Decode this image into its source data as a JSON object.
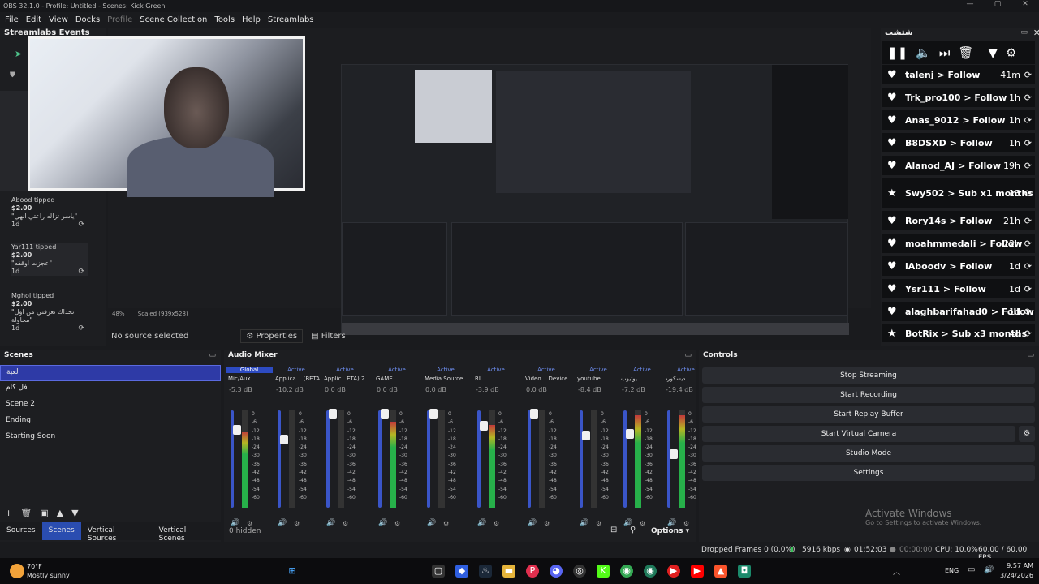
{
  "window": {
    "title": "OBS 32.1.0 - Profile: Untitled - Scenes: Kick Green",
    "controls": [
      "—",
      "▢",
      "✕"
    ]
  },
  "menu": [
    "File",
    "Edit",
    "View",
    "Docks",
    "Profile",
    "Scene Collection",
    "Tools",
    "Help",
    "Streamlabs"
  ],
  "streamlabs_dock": {
    "title": "Streamlabs Events",
    "tips": [
      {
        "name": "Abood tipped",
        "amount": "$2.00",
        "message": "\"ياسر تزاله راعتي انهي\"",
        "age": "1d"
      },
      {
        "name": "Yar111 tipped",
        "amount": "$2.00",
        "message": "\"عجزت اوقفه\"",
        "age": "1d"
      },
      {
        "name": "Mghol tipped",
        "amount": "$2.00",
        "message": "\"اتحداك تعرفني من اول محاولة\"",
        "age": "1d"
      }
    ]
  },
  "preview": {
    "zoom": "48%",
    "scaled": "Scaled (939x528)"
  },
  "source_bar": {
    "status": "No source selected",
    "properties": "Properties",
    "filters": "Filters"
  },
  "chat_dock": {
    "title": "شتشت",
    "events": [
      {
        "user": "talenj",
        "action": "> Follow",
        "time": "41m"
      },
      {
        "user": "Trk_pro100",
        "action": "> Follow",
        "time": "1h"
      },
      {
        "user": "Anas_9012",
        "action": "> Follow",
        "time": "1h"
      },
      {
        "user": "B8DSXD",
        "action": "> Follow",
        "time": "1h"
      },
      {
        "user": "Alanod_AJ",
        "action": "> Follow",
        "time": "19h"
      },
      {
        "user": "Swy502",
        "action": "> Sub x1 months",
        "time": "13"
      },
      {
        "user": "Rory14s",
        "action": "> Follow",
        "time": "21h"
      },
      {
        "user": "moahmmedali",
        "action": "> Follow",
        "time": "22h"
      },
      {
        "user": "iAboodv",
        "action": "> Follow",
        "time": "1d"
      },
      {
        "user": "Ysr111",
        "action": "> Follow",
        "time": "1d"
      },
      {
        "user": "alaghbarifahad0",
        "action": "> Follow",
        "time": "1d"
      },
      {
        "user": "BotRix",
        "action": "> Sub x3 months",
        "time": "4d"
      }
    ]
  },
  "scenes": {
    "title": "Scenes",
    "items": [
      "لعبة",
      "فل كام",
      "Scene 2",
      "Ending",
      "Starting Soon"
    ],
    "selected": 0
  },
  "dock_tabs": [
    "Sources",
    "Scenes",
    "Vertical Sources",
    "Vertical Scenes"
  ],
  "audio_mixer": {
    "title": "Audio Mixer",
    "hidden": "0 hidden",
    "options": "Options",
    "channels": [
      {
        "status": "Global",
        "name": "Mic/Aux",
        "db": "-5.3 dB",
        "level": 0.8,
        "meter": 0.78
      },
      {
        "status": "Active",
        "name": "Applica... (BETA)",
        "db": "-10.2 dB",
        "level": 0.7,
        "meter": 0.0
      },
      {
        "status": "Active",
        "name": "Applic...ETA) 2",
        "db": "0.0 dB",
        "level": 0.97,
        "meter": 0.0
      },
      {
        "status": "Active",
        "name": "GAME",
        "db": "0.0 dB",
        "level": 0.97,
        "meter": 0.88
      },
      {
        "status": "Active",
        "name": "Media Source",
        "db": "0.0 dB",
        "level": 0.97,
        "meter": 0.0
      },
      {
        "status": "Active",
        "name": "RL",
        "db": "-3.9 dB",
        "level": 0.84,
        "meter": 0.85
      },
      {
        "status": "Active",
        "name": "Video ...Device",
        "db": "0.0 dB",
        "level": 0.97,
        "meter": 0.0
      },
      {
        "status": "Active",
        "name": "youtube",
        "db": "-8.4 dB",
        "level": 0.74,
        "meter": 0.0
      },
      {
        "status": "Active",
        "name": "يوتيوب",
        "db": "-7.2 dB",
        "level": 0.76,
        "meter": 0.95
      },
      {
        "status": "Active",
        "name": "ديسكورد",
        "db": "-19.4 dB",
        "level": 0.55,
        "meter": 0.95
      }
    ],
    "scale": [
      "0",
      "-6",
      "-12",
      "-18",
      "-24",
      "-30",
      "-36",
      "-42",
      "-48",
      "-54",
      "-60"
    ]
  },
  "controls": {
    "title": "Controls",
    "buttons": [
      "Stop Streaming",
      "Start Recording",
      "Start Replay Buffer",
      "Start Virtual Camera",
      "Studio Mode",
      "Settings"
    ]
  },
  "watermark": {
    "line1": "Activate Windows",
    "line2": "Go to Settings to activate Windows."
  },
  "status": {
    "dropped": "Dropped Frames 0 (0.0%)",
    "kbps": "5916 kbps",
    "stream_time": "01:52:03",
    "rec_time": "00:00:00",
    "cpu": "CPU: 10.0%",
    "fps": "60.00 / 60.00 FPS"
  },
  "taskbar": {
    "temp": "70°F",
    "weather": "Mostly sunny",
    "lang": "ENG",
    "time": "9:57 AM",
    "date": "3/24/2026"
  }
}
